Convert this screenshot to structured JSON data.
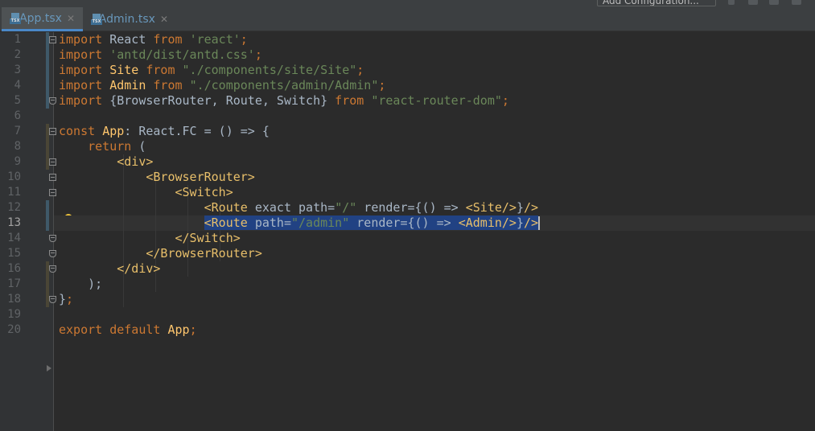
{
  "tabs": [
    {
      "label": "App.tsx",
      "active": true,
      "file_badge": "TSX"
    },
    {
      "label": "Admin.tsx",
      "active": false,
      "file_badge": "TSX"
    }
  ],
  "run_config": {
    "label": "Add Configuration..."
  },
  "colors": {
    "background": "#2b2b2b",
    "gutter": "#313335",
    "keyword": "#cc7832",
    "string": "#6a8759",
    "identifier": "#ffc66d",
    "jsx_tag": "#e8bf6a",
    "default_text": "#a9b7c6",
    "selection": "#214283",
    "active_tab_underline": "#4a88c7"
  },
  "editor": {
    "current_line": 13,
    "line_numbers": [
      "1",
      "2",
      "3",
      "4",
      "5",
      "6",
      "7",
      "8",
      "9",
      "10",
      "11",
      "12",
      "13",
      "14",
      "15",
      "16",
      "17",
      "18",
      "19",
      "20"
    ],
    "lines": [
      [
        {
          "t": "import",
          "c": "kw"
        },
        {
          "t": " React ",
          "c": "def"
        },
        {
          "t": "from",
          "c": "kw"
        },
        {
          "t": " ",
          "c": "def"
        },
        {
          "t": "'react'",
          "c": "str"
        },
        {
          "t": ";",
          "c": "kw"
        }
      ],
      [
        {
          "t": "import",
          "c": "kw"
        },
        {
          "t": " ",
          "c": "def"
        },
        {
          "t": "'antd/dist/antd.css'",
          "c": "str"
        },
        {
          "t": ";",
          "c": "kw"
        }
      ],
      [
        {
          "t": "import",
          "c": "kw"
        },
        {
          "t": " ",
          "c": "def"
        },
        {
          "t": "Site",
          "c": "id"
        },
        {
          "t": " ",
          "c": "def"
        },
        {
          "t": "from",
          "c": "kw"
        },
        {
          "t": " ",
          "c": "def"
        },
        {
          "t": "\"./components/site/Site\"",
          "c": "str"
        },
        {
          "t": ";",
          "c": "kw"
        }
      ],
      [
        {
          "t": "import",
          "c": "kw"
        },
        {
          "t": " ",
          "c": "def"
        },
        {
          "t": "Admin",
          "c": "id"
        },
        {
          "t": " ",
          "c": "def"
        },
        {
          "t": "from",
          "c": "kw"
        },
        {
          "t": " ",
          "c": "def"
        },
        {
          "t": "\"./components/admin/Admin\"",
          "c": "str"
        },
        {
          "t": ";",
          "c": "kw"
        }
      ],
      [
        {
          "t": "import",
          "c": "kw"
        },
        {
          "t": " {BrowserRouter, Route, Switch} ",
          "c": "def"
        },
        {
          "t": "from",
          "c": "kw"
        },
        {
          "t": " ",
          "c": "def"
        },
        {
          "t": "\"react-router-dom\"",
          "c": "str"
        },
        {
          "t": ";",
          "c": "kw"
        }
      ],
      [],
      [
        {
          "t": "const",
          "c": "kw"
        },
        {
          "t": " ",
          "c": "def"
        },
        {
          "t": "App",
          "c": "id"
        },
        {
          "t": ": React.FC = () => {",
          "c": "def"
        }
      ],
      [
        {
          "t": "    ",
          "c": "def"
        },
        {
          "t": "return",
          "c": "kw"
        },
        {
          "t": " (",
          "c": "def"
        }
      ],
      [
        {
          "t": "        ",
          "c": "def"
        },
        {
          "t": "<div>",
          "c": "tag"
        }
      ],
      [
        {
          "t": "            ",
          "c": "def"
        },
        {
          "t": "<BrowserRouter>",
          "c": "tag"
        }
      ],
      [
        {
          "t": "                ",
          "c": "def"
        },
        {
          "t": "<Switch>",
          "c": "tag"
        }
      ],
      [
        {
          "t": "                    ",
          "c": "def"
        },
        {
          "t": "<Route",
          "c": "tag"
        },
        {
          "t": " exact path=",
          "c": "def"
        },
        {
          "t": "\"/\"",
          "c": "str"
        },
        {
          "t": " render={() => ",
          "c": "def"
        },
        {
          "t": "<Site/>",
          "c": "tag"
        },
        {
          "t": "}",
          "c": "def"
        },
        {
          "t": "/>",
          "c": "tag"
        }
      ],
      [
        {
          "t": "                    ",
          "c": "def"
        },
        {
          "t": "<Route",
          "c": "tag",
          "sel": true
        },
        {
          "t": " path=",
          "c": "def",
          "sel": true
        },
        {
          "t": "\"/admin\"",
          "c": "str",
          "sel": true
        },
        {
          "t": " render={() => ",
          "c": "def",
          "sel": true
        },
        {
          "t": "<Admin/>",
          "c": "tag",
          "sel": true
        },
        {
          "t": "}",
          "c": "def",
          "sel": true
        },
        {
          "t": "/>",
          "c": "tag",
          "sel": true
        }
      ],
      [
        {
          "t": "                ",
          "c": "def"
        },
        {
          "t": "</Switch>",
          "c": "tag"
        }
      ],
      [
        {
          "t": "            ",
          "c": "def"
        },
        {
          "t": "</BrowserRouter>",
          "c": "tag"
        }
      ],
      [
        {
          "t": "        ",
          "c": "def"
        },
        {
          "t": "</div>",
          "c": "tag"
        }
      ],
      [
        {
          "t": "    );",
          "c": "def"
        }
      ],
      [
        {
          "t": "}",
          "c": "def"
        },
        {
          "t": ";",
          "c": "kw"
        }
      ],
      [],
      [
        {
          "t": "export",
          "c": "kw"
        },
        {
          "t": " ",
          "c": "def"
        },
        {
          "t": "default",
          "c": "kw"
        },
        {
          "t": " ",
          "c": "def"
        },
        {
          "t": "App",
          "c": "id"
        },
        {
          "t": ";",
          "c": "kw"
        }
      ]
    ]
  }
}
